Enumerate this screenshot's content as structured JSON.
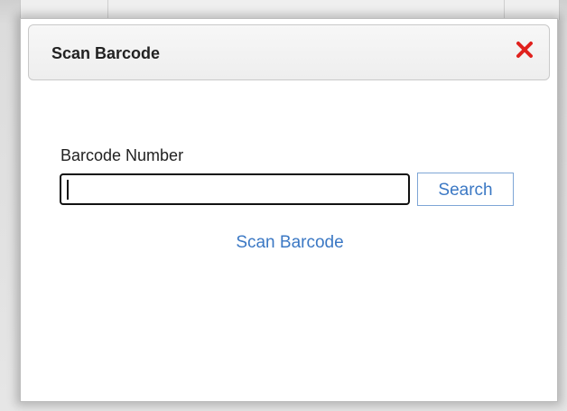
{
  "dialog": {
    "title": "Scan Barcode",
    "close_icon": "close-icon",
    "close_color": "#e0211d"
  },
  "form": {
    "field_label": "Barcode Number",
    "input_value": "",
    "search_label": "Search",
    "scan_link_label": "Scan Barcode"
  },
  "colors": {
    "link": "#3b78c4",
    "search_border": "#7ea6d6"
  }
}
